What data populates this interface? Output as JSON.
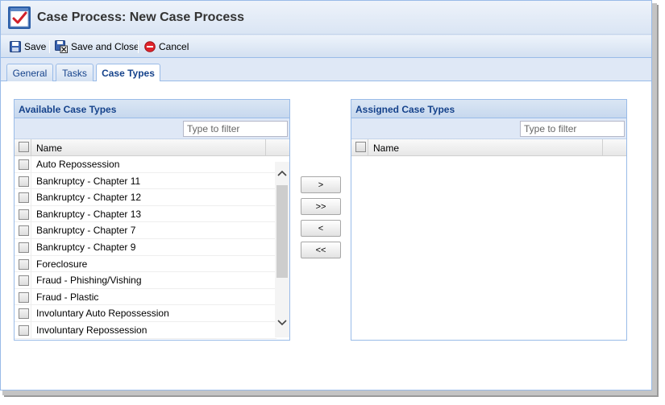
{
  "window": {
    "title": "Case Process: New Case Process"
  },
  "toolbar": {
    "save_label": "Save",
    "save_close_label": "Save and Close",
    "cancel_label": "Cancel"
  },
  "tabs": [
    {
      "label": "General",
      "active": false
    },
    {
      "label": "Tasks",
      "active": false
    },
    {
      "label": "Case Types",
      "active": true
    }
  ],
  "available": {
    "title": "Available Case Types",
    "filter_placeholder": "Type to filter",
    "column_name": "Name",
    "rows": [
      "Auto Repossession",
      "Bankruptcy - Chapter 11",
      "Bankruptcy - Chapter 12",
      "Bankruptcy - Chapter 13",
      "Bankruptcy - Chapter 7",
      "Bankruptcy - Chapter 9",
      "Foreclosure",
      "Fraud - Phishing/Vishing",
      "Fraud - Plastic",
      "Involuntary Auto Repossession",
      "Involuntary Repossession"
    ]
  },
  "assigned": {
    "title": "Assigned Case Types",
    "filter_placeholder": "Type to filter",
    "column_name": "Name",
    "rows": []
  },
  "move_buttons": {
    "add": ">",
    "add_all": ">>",
    "remove": "<",
    "remove_all": "<<"
  },
  "colors": {
    "accent": "#15428b",
    "border": "#99bbe8",
    "panel_bg": "#dfe8f6"
  }
}
